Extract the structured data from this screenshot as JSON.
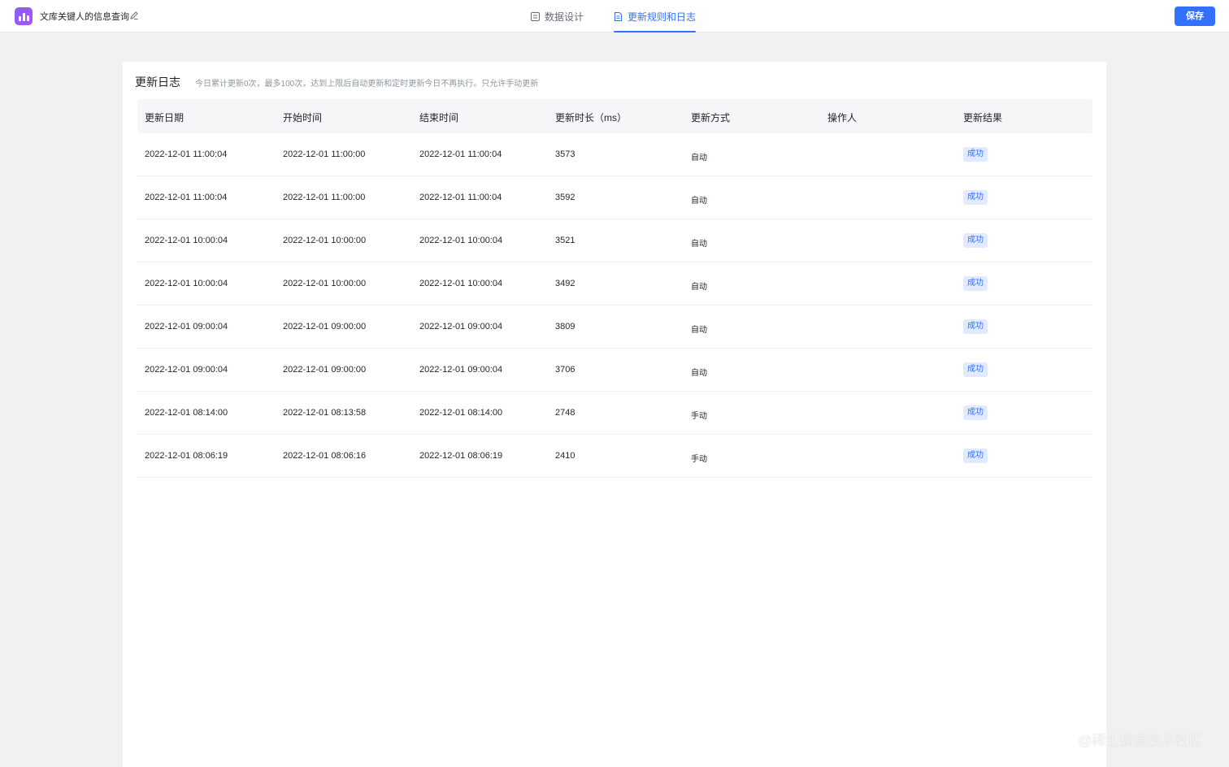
{
  "header": {
    "app_title": "文库关键人的信息查询",
    "tabs": [
      {
        "label": "数据设计",
        "active": false
      },
      {
        "label": "更新规则和日志",
        "active": true
      }
    ],
    "save_label": "保存",
    "accent": "#3370ff"
  },
  "log": {
    "title": "更新日志",
    "note": "今日累计更新0次，最多100次，达到上限后自动更新和定时更新今日不再执行。只允许手动更新",
    "columns": [
      "更新日期",
      "开始时间",
      "结束时间",
      "更新时长（ms）",
      "更新方式",
      "操作人",
      "更新结果"
    ],
    "rows": [
      {
        "date": "2022-12-01 11:00:04",
        "start": "2022-12-01 11:00:00",
        "end": "2022-12-01 11:00:04",
        "duration": "3573",
        "method": "自动",
        "operator": "",
        "result": "成功"
      },
      {
        "date": "2022-12-01 11:00:04",
        "start": "2022-12-01 11:00:00",
        "end": "2022-12-01 11:00:04",
        "duration": "3592",
        "method": "自动",
        "operator": "",
        "result": "成功"
      },
      {
        "date": "2022-12-01 10:00:04",
        "start": "2022-12-01 10:00:00",
        "end": "2022-12-01 10:00:04",
        "duration": "3521",
        "method": "自动",
        "operator": "",
        "result": "成功"
      },
      {
        "date": "2022-12-01 10:00:04",
        "start": "2022-12-01 10:00:00",
        "end": "2022-12-01 10:00:04",
        "duration": "3492",
        "method": "自动",
        "operator": "",
        "result": "成功"
      },
      {
        "date": "2022-12-01 09:00:04",
        "start": "2022-12-01 09:00:00",
        "end": "2022-12-01 09:00:04",
        "duration": "3809",
        "method": "自动",
        "operator": "",
        "result": "成功"
      },
      {
        "date": "2022-12-01 09:00:04",
        "start": "2022-12-01 09:00:00",
        "end": "2022-12-01 09:00:04",
        "duration": "3706",
        "method": "自动",
        "operator": "",
        "result": "成功"
      },
      {
        "date": "2022-12-01 08:14:00",
        "start": "2022-12-01 08:13:58",
        "end": "2022-12-01 08:14:00",
        "duration": "2748",
        "method": "手动",
        "operator": "",
        "result": "成功"
      },
      {
        "date": "2022-12-01 08:06:19",
        "start": "2022-12-01 08:06:16",
        "end": "2022-12-01 08:06:19",
        "duration": "2410",
        "method": "手动",
        "operator": "",
        "result": "成功"
      }
    ]
  },
  "watermark": "@稀土掘金技术社区"
}
